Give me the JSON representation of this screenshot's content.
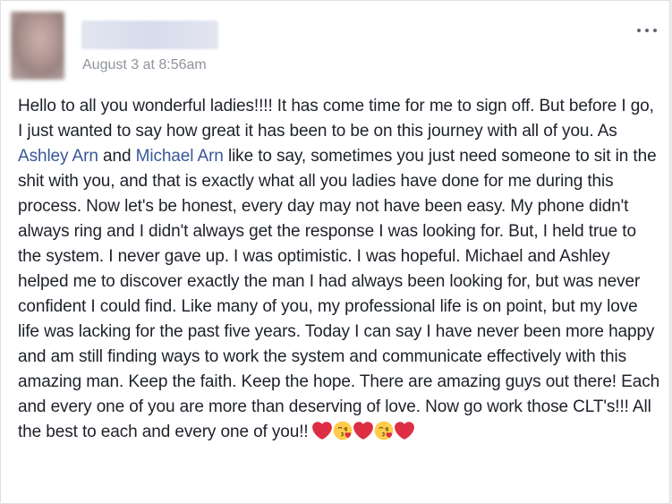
{
  "post": {
    "timestamp": "August 3 at 8:56am",
    "more_options_icon": "more-options-icon",
    "body": {
      "p1": "Hello to all you wonderful ladies!!!! It has come time for me to sign off. But before I go, I just wanted to say how great it has been to be on this journey with all of you. As ",
      "mention1": "Ashley Arn",
      "p2": " and ",
      "mention2": "Michael Arn",
      "p3": " like to say, sometimes you just need someone to sit in the shit with you, and that is exactly what all you ladies have done for me during this process. Now let's be honest, every day may not have been easy. My phone didn't always ring and I didn't always get the response I was looking for. But, I held true to the system. I never gave up. I was optimistic. I was hopeful. Michael and Ashley helped me to discover exactly the man I had always been looking for, but was never confident I could find. Like many of you, my professional life is on point, but my love life was lacking for the past five years. Today I can say I have never been more happy and am still finding ways to work the system and communicate effectively with this amazing man. Keep the faith. Keep the hope. There are amazing guys out there! Each and every one of you are more than deserving of love. Now go work those CLT's!!! All the best to each and every one of you!!"
    },
    "emojis": [
      "heart-icon",
      "kissing-face-icon",
      "heart-icon",
      "kissing-face-icon",
      "heart-icon"
    ]
  },
  "colors": {
    "link": "#385898",
    "timestamp": "#90949c",
    "text": "#1d2129",
    "heart": "#dd2e44"
  }
}
